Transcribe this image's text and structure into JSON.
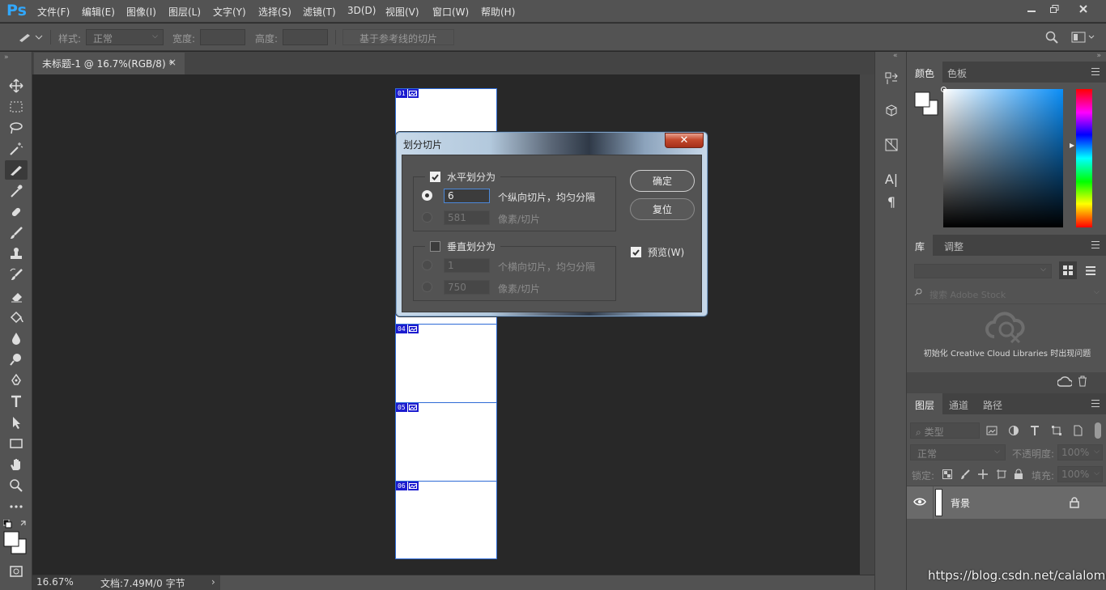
{
  "app": {
    "logo": "Ps"
  },
  "menu": [
    "文件(F)",
    "编辑(E)",
    "图像(I)",
    "图层(L)",
    "文字(Y)",
    "选择(S)",
    "滤镜(T)",
    "3D(D)",
    "视图(V)",
    "窗口(W)",
    "帮助(H)"
  ],
  "options": {
    "style_label": "样式:",
    "style_value": "正常",
    "width_label": "宽度:",
    "height_label": "高度:",
    "guides_button": "基于参考线的切片"
  },
  "document": {
    "tab_title": "未标题-1 @ 16.7%(RGB/8) *",
    "slices": [
      "01",
      "04",
      "05",
      "06"
    ]
  },
  "status": {
    "zoom": "16.67%",
    "doc_info": "文档:7.49M/0 字节"
  },
  "dialog": {
    "title": "划分切片",
    "horizontal": {
      "label": "水平划分为",
      "checked": true,
      "count_value": "6",
      "count_label": "个纵向切片，均匀分隔",
      "pixels_value": "581",
      "pixels_label": "像素/切片"
    },
    "vertical": {
      "label": "垂直划分为",
      "checked": false,
      "count_value": "1",
      "count_label": "个横向切片，均匀分隔",
      "pixels_value": "750",
      "pixels_label": "像素/切片"
    },
    "ok_button": "确定",
    "reset_button": "复位",
    "preview_label": "预览(W)",
    "preview_checked": true
  },
  "color_panel": {
    "tabs": [
      "颜色",
      "色板"
    ]
  },
  "library_panel": {
    "tabs": [
      "库",
      "调整"
    ],
    "search_placeholder": "搜索 Adobe Stock",
    "init_message": "初始化 Creative Cloud Libraries 时出现问题"
  },
  "layers_panel": {
    "tabs": [
      "图层",
      "通道",
      "路径"
    ],
    "filter_kind": "类型",
    "blend_mode": "正常",
    "opacity_label": "不透明度:",
    "opacity_value": "100%",
    "lock_label": "锁定:",
    "fill_label": "填充:",
    "fill_value": "100%",
    "layers": [
      {
        "name": "背景",
        "visible": true,
        "locked": true
      }
    ]
  },
  "watermark": "https://blog.csdn.net/calalomo"
}
